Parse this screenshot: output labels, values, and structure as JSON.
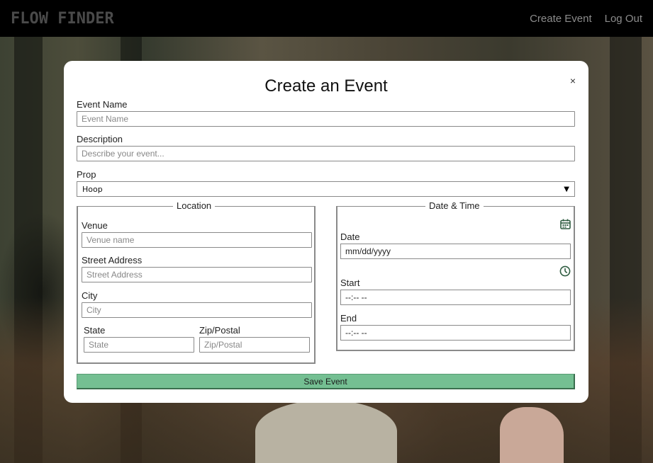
{
  "nav": {
    "brand": "FLOW FINDER",
    "links": [
      {
        "label": "Create Event"
      },
      {
        "label": "Log Out"
      }
    ]
  },
  "modal": {
    "title": "Create an Event",
    "close_label": "×",
    "event_name": {
      "label": "Event Name",
      "placeholder": "Event Name",
      "value": ""
    },
    "description": {
      "label": "Description",
      "placeholder": "Describe your event...",
      "value": ""
    },
    "prop": {
      "label": "Prop",
      "selected": "Hoop"
    },
    "location": {
      "legend": "Location",
      "venue": {
        "label": "Venue",
        "placeholder": "Venue name"
      },
      "street": {
        "label": "Street Address",
        "placeholder": "Street Address"
      },
      "city": {
        "label": "City",
        "placeholder": "City"
      },
      "state": {
        "label": "State",
        "placeholder": "State"
      },
      "zip": {
        "label": "Zip/Postal",
        "placeholder": "Zip/Postal"
      }
    },
    "datetime": {
      "legend": "Date & Time",
      "date": {
        "label": "Date",
        "value": "mm/dd/yyyy",
        "icon": "calendar-icon"
      },
      "start": {
        "label": "Start",
        "value": "--:-- --",
        "icon": "clock-icon"
      },
      "end": {
        "label": "End",
        "value": "--:-- --"
      }
    },
    "save_label": "Save Event"
  },
  "colors": {
    "nav_bg": "#000000",
    "accent_green": "#74bf92",
    "icon_green": "#2e5c40"
  }
}
